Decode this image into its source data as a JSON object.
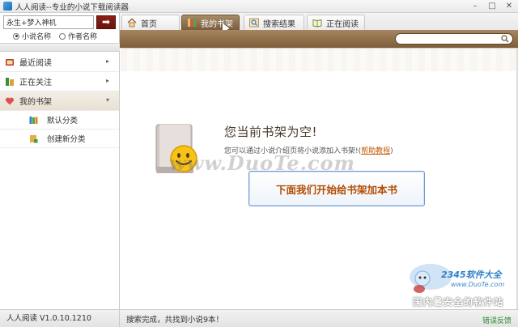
{
  "window": {
    "title": "人人阅读--专业的小说下载阅读器",
    "min_glyph": "–",
    "max_glyph": "□",
    "close_glyph": "✕"
  },
  "sidebar": {
    "search": {
      "value": "永生+梦入神机",
      "go_glyph": "➡"
    },
    "radios": [
      {
        "label": "小说名称",
        "checked": true
      },
      {
        "label": "作者名称",
        "checked": false
      }
    ],
    "items": [
      {
        "label": "最近阅读",
        "icon": "recent-reading-icon",
        "arrow": "▸"
      },
      {
        "label": "正在关注",
        "icon": "following-icon",
        "arrow": "▸"
      },
      {
        "label": "我的书架",
        "icon": "bookshelf-heart-icon",
        "arrow": "▾"
      }
    ],
    "sub_items": [
      {
        "label": "默认分类",
        "icon": "books-icon"
      },
      {
        "label": "创建新分类",
        "icon": "new-category-icon"
      }
    ]
  },
  "tabs": [
    {
      "label": "首页",
      "icon": "home-icon",
      "active": false
    },
    {
      "label": "我的书架",
      "icon": "bookshelf-icon",
      "active": true
    },
    {
      "label": "搜索结果",
      "icon": "search-results-icon",
      "active": false
    },
    {
      "label": "正在阅读",
      "icon": "open-book-icon",
      "active": false
    }
  ],
  "main": {
    "empty_title": "您当前书架为空!",
    "empty_desc": "您可以通过小说介绍页将小说添加入书架!(",
    "help_link": "帮助教程",
    "empty_desc_end": ")",
    "cta_label": "下面我们开始给书架加本书",
    "watermark": "www.DuoTe.com"
  },
  "corner_watermark": {
    "brand": "2345软件大全",
    "url": "www.DuoTe.com",
    "slogan": "国内最安全的软件站"
  },
  "status": {
    "version": "人人阅读 V1.0.10.1210",
    "message": "搜索完成，共找到小说9本！",
    "report": "错误反馈"
  },
  "colors": {
    "brown_bar": "#8a6a45",
    "accent_orange": "#b54c00",
    "cta_border": "#6f9bd3",
    "status_green": "#2a8a2a"
  }
}
